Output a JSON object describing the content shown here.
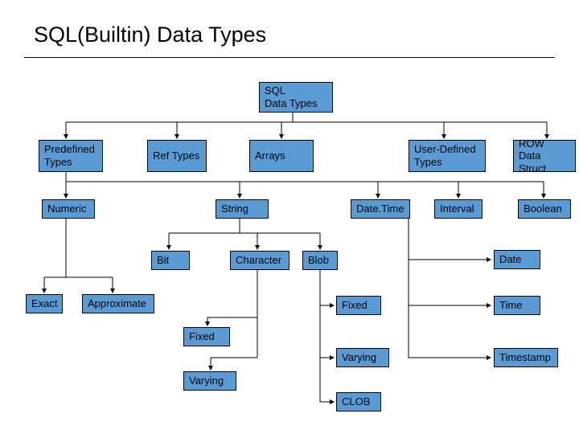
{
  "title": "SQL(Builtin) Data Types",
  "nodes": {
    "root": "SQL\nData Types",
    "predefined": "Predefined\nTypes",
    "ref": "Ref Types",
    "arrays": "Arrays",
    "userdef": "User-Defined\nTypes",
    "row": "ROW\nData Struct",
    "numeric": "Numeric",
    "string": "String",
    "datetime": "Date.Time",
    "interval": "Interval",
    "boolean": "Boolean",
    "bit": "Bit",
    "character": "Character",
    "blob": "Blob",
    "exact": "Exact",
    "approx": "Approximate",
    "fixed_char": "Fixed",
    "varying_char": "Varying",
    "fixed_blob": "Fixed",
    "varying_blob": "Varying",
    "clob": "CLOB",
    "date": "Date",
    "time": "Time",
    "timestamp": "Timestamp"
  }
}
